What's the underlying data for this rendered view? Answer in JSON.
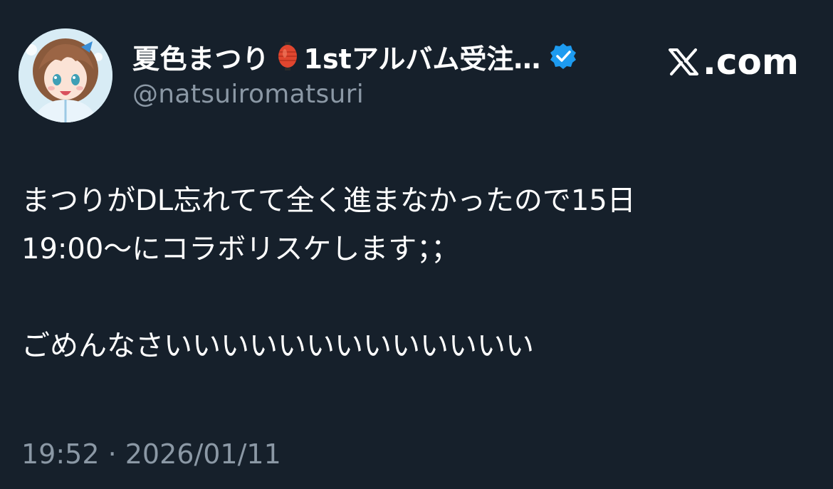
{
  "post": {
    "author": {
      "display_name": "夏色まつり",
      "display_name_suffix": "1stアルバム受注…",
      "handle": "@natsuiromatsuri",
      "avatar_icon": "avatar-image",
      "verified_icon": "verified-badge-icon",
      "emoji_icon": "lantern-icon"
    },
    "site": {
      "logo_text": ".com",
      "logo_icon": "x-logo-icon"
    },
    "body": {
      "line1": "まつりがDL忘れてて全く進まなかったので15日",
      "line2": "19:00〜にコラボリスケします；；",
      "line3": "ごめんなさいいいいいいいいいいいいい"
    },
    "timestamp": "19:52 · 2026/01/11"
  },
  "colors": {
    "background": "#16202b",
    "text_primary": "#ffffff",
    "text_secondary": "#8b98a5",
    "verified_blue": "#1d9bf0"
  }
}
